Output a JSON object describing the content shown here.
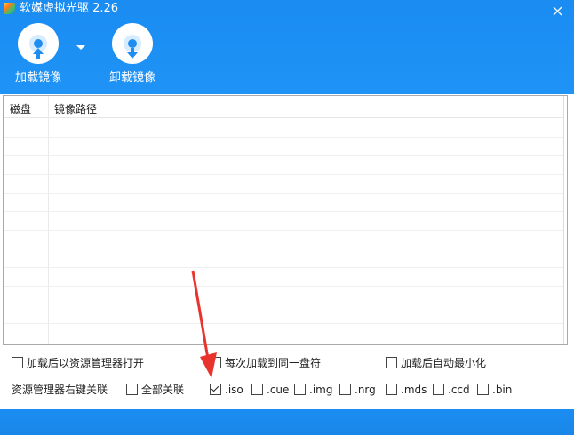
{
  "window": {
    "title": "软媒虚拟光驱 2.26"
  },
  "toolbar": {
    "load_label": "加载镜像",
    "unload_label": "卸载镜像"
  },
  "list": {
    "columns": [
      "磁盘",
      "镜像路径"
    ]
  },
  "options": {
    "open_explorer": {
      "label": "加载后以资源管理器打开",
      "checked": false
    },
    "same_drive": {
      "label": "每次加载到同一盘符",
      "checked": false
    },
    "auto_minimize": {
      "label": "加载后自动最小化",
      "checked": false
    },
    "assoc_title": "资源管理器右键关联",
    "all_assoc": {
      "label": "全部关联",
      "checked": false
    },
    "ext": [
      {
        "label": ".iso",
        "checked": true
      },
      {
        "label": ".cue",
        "checked": false
      },
      {
        "label": ".img",
        "checked": false
      },
      {
        "label": ".nrg",
        "checked": false
      },
      {
        "label": ".mds",
        "checked": false
      },
      {
        "label": ".ccd",
        "checked": false
      },
      {
        "label": ".bin",
        "checked": false
      }
    ]
  },
  "colors": {
    "titlebar": "#1f8ef0",
    "annotation_arrow": "#e8342c"
  }
}
